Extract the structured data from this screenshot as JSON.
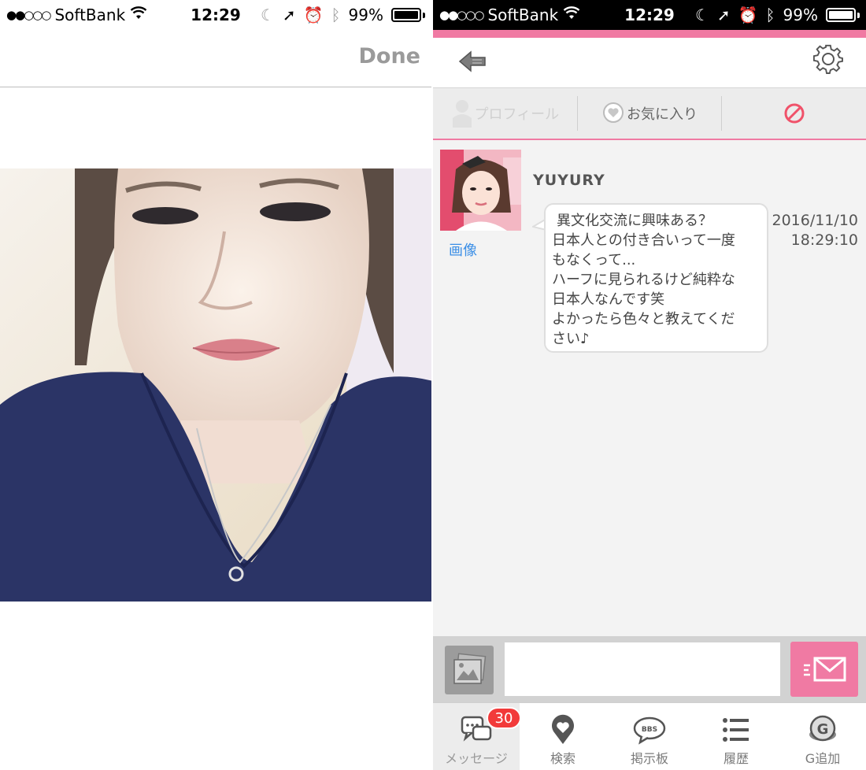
{
  "status_bar": {
    "carrier": "SoftBank",
    "time": "12:29",
    "battery": "99%"
  },
  "left": {
    "nav": {
      "done_label": "Done"
    },
    "photo": {
      "alt": "profile photo"
    }
  },
  "right": {
    "tabs": {
      "profile": "プロフィール",
      "favorite": "お気に入り"
    },
    "message": {
      "username": "YUYURY",
      "image_link": "画像",
      "lines": [
        "異文化交流に興味ある？",
        "日本人との付き合いって一度",
        "もなくって...",
        "ハーフに見られるけど純粋な",
        "日本人なんです笑",
        "よかったら色々と教えてくだ",
        "さい♪"
      ],
      "date": "2016/11/10",
      "time": "18:29:10"
    },
    "composer": {
      "placeholder": ""
    },
    "tabbar": {
      "items": [
        {
          "label": "メッセージ",
          "badge": "30"
        },
        {
          "label": "検索"
        },
        {
          "label": "掲示板",
          "icon_text": "BBS"
        },
        {
          "label": "履歴"
        },
        {
          "label": "G追加",
          "icon_text": "G"
        }
      ]
    },
    "colors": {
      "accent": "#f07aa3",
      "badge": "#f23a3a",
      "link": "#3a8ee6"
    }
  }
}
